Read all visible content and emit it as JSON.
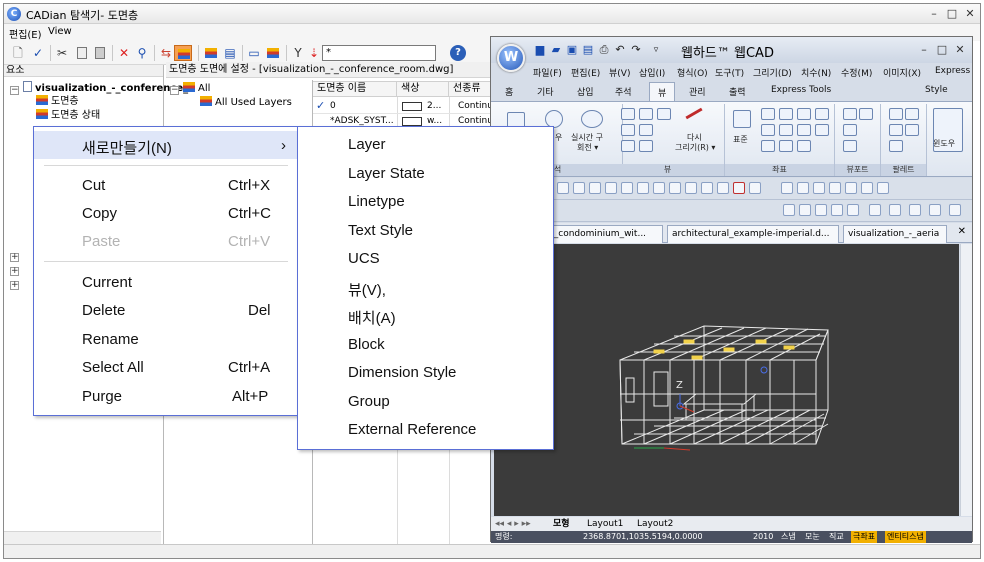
{
  "explorer": {
    "title": "CADian 탐색기- 도면층",
    "menu": [
      "편집(E)",
      "View"
    ],
    "filter_value": "*",
    "help_label": "?",
    "left_pane": {
      "header": "요소",
      "root": "visualization_-_conference_r",
      "items": [
        "도면층",
        "도면층 상태"
      ]
    },
    "mid_header": "도면층 도면에 설정 - [visualization_-_conference_room.dwg]",
    "mid_tree": {
      "root": "All",
      "child": "All Used Layers"
    },
    "grid": {
      "columns": [
        "도면층 이름",
        "색상",
        "선종류"
      ],
      "rows": [
        {
          "check": "✓",
          "name": "0",
          "color": "2...",
          "linetype": "Continu"
        },
        {
          "check": "",
          "name": "*ADSK_SYST...",
          "color": "w...",
          "linetype": "Continu"
        }
      ]
    }
  },
  "cad": {
    "title": "웹하드™ 웹CAD",
    "logo": "W",
    "menu": [
      "파일(F)",
      "편집(E)",
      "뷰(V)",
      "삽입(I)",
      "형식(O)",
      "도구(T)",
      "그리기(D)",
      "치수(N)",
      "수정(M)",
      "이미지(X)",
      "Express"
    ],
    "ribbon_tabs": [
      "홈",
      "기타",
      "삽입",
      "주석",
      "뷰",
      "관리",
      "출력",
      "Express Tools"
    ],
    "active_tab": "뷰",
    "style_label": "Style",
    "ribbon": {
      "navigate_text": "실시간 구\n회전",
      "draw_label": "다시\n그리기(R)",
      "standard_label": "표준",
      "window_label": "윈도우",
      "group_labels": [
        "뷰",
        "좌표",
        "뷰포트",
        "팔레트"
      ]
    },
    "doc_tabs": [
      "_-_condominium_wit...",
      "architectural_example-imperial.d...",
      "visualization_-_aeria"
    ],
    "layout_tabs": [
      "모형",
      "Layout1",
      "Layout2"
    ],
    "axis_label": "Z",
    "status": {
      "prompt": "명령:",
      "coords": "2368.8701,1035.5194,0.0000",
      "flags": [
        "2010",
        "스냅",
        "모눈",
        "직교",
        "극좌표",
        "엔티티스냅"
      ]
    }
  },
  "context_menu": {
    "items": [
      {
        "label": "새로만들기(N)",
        "submenu": true
      },
      {
        "label": "Cut",
        "shortcut": "Ctrl+X"
      },
      {
        "label": "Copy",
        "shortcut": "Ctrl+C"
      },
      {
        "label": "Paste",
        "shortcut": "Ctrl+V",
        "disabled": true
      },
      {
        "label": "Current"
      },
      {
        "label": "Delete",
        "shortcut": "Del"
      },
      {
        "label": "Rename"
      },
      {
        "label": "Select All",
        "shortcut": "Ctrl+A"
      },
      {
        "label": "Purge",
        "shortcut": "Alt+P"
      }
    ],
    "submenu_arrow": "›"
  },
  "submenu": {
    "items": [
      "Layer",
      "Layer State",
      "Linetype",
      "Text Style",
      "UCS",
      "뷰(V),",
      "배치(A)",
      "Block",
      "Dimension Style",
      "Group",
      "External Reference"
    ]
  },
  "colors": {
    "menu_border": "#5a6fd6",
    "viewport_bg": "#3b3b3b",
    "wire": "#e8e8e8",
    "highlight": "#f2d24a"
  }
}
